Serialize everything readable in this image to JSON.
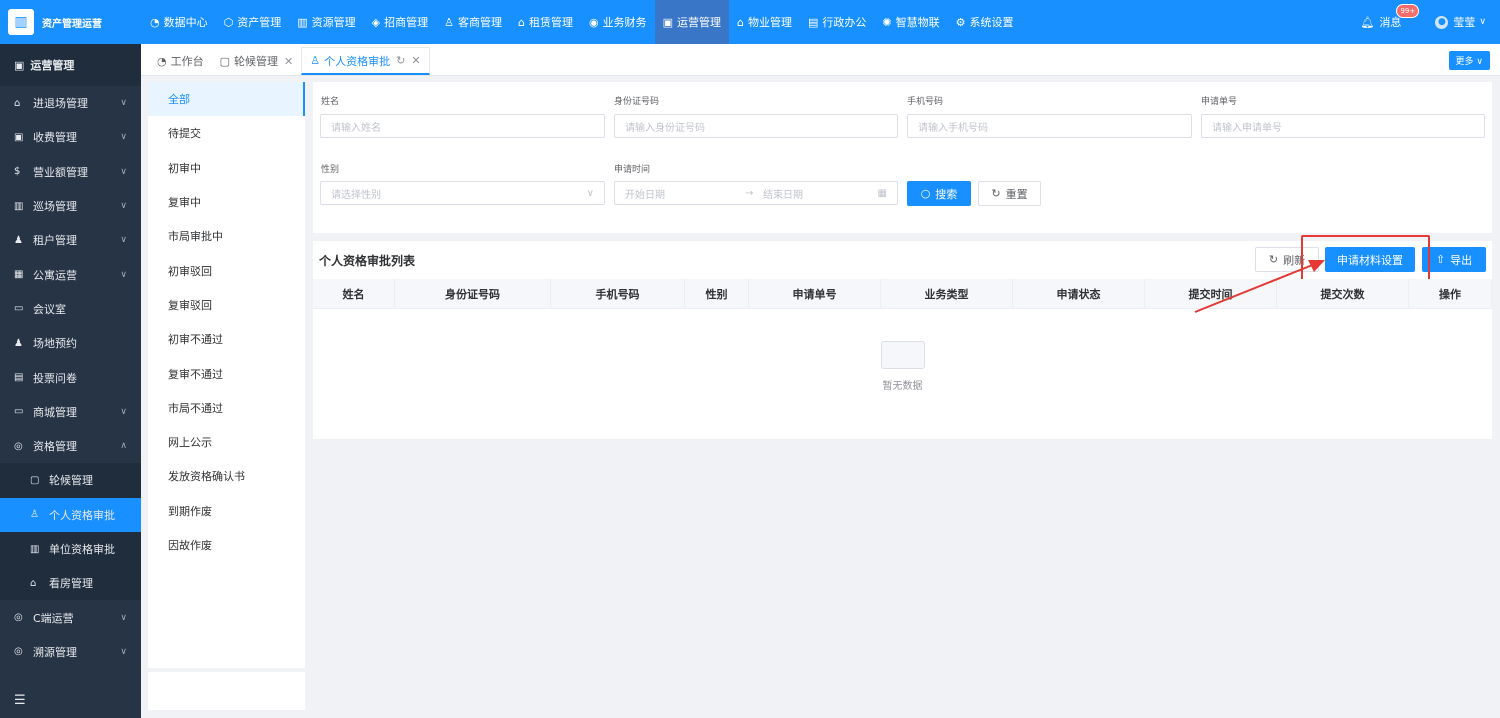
{
  "app": {
    "title": "资产管理运营",
    "logo_icon": "building-icon"
  },
  "topnav": [
    {
      "label": "数据中心",
      "icon": "dashboard-icon",
      "glyph": "◔"
    },
    {
      "label": "资产管理",
      "icon": "cube-icon",
      "glyph": "⬡"
    },
    {
      "label": "资源管理",
      "icon": "building-icon",
      "glyph": "▥"
    },
    {
      "label": "招商管理",
      "icon": "tag-icon",
      "glyph": "◈"
    },
    {
      "label": "客商管理",
      "icon": "users-icon",
      "glyph": "♙"
    },
    {
      "label": "租赁管理",
      "icon": "home-icon",
      "glyph": "⌂"
    },
    {
      "label": "业务财务",
      "icon": "coin-icon",
      "glyph": "◉"
    },
    {
      "label": "运营管理",
      "icon": "chart-icon",
      "glyph": "▣"
    },
    {
      "label": "物业管理",
      "icon": "house-icon",
      "glyph": "⌂"
    },
    {
      "label": "行政办公",
      "icon": "briefcase-icon",
      "glyph": "▤"
    },
    {
      "label": "智慧物联",
      "icon": "iot-icon",
      "glyph": "✺"
    },
    {
      "label": "系统设置",
      "icon": "gear-icon",
      "glyph": "⚙"
    }
  ],
  "topnav_active": 7,
  "header_right": {
    "messages": "消息",
    "badge": "99+",
    "user": "莹莹"
  },
  "sidebar": {
    "title": "运营管理",
    "items": [
      {
        "label": "进退场管理",
        "glyph": "⌂",
        "chev": "∨"
      },
      {
        "label": "收费管理",
        "glyph": "▣",
        "chev": "∨"
      },
      {
        "label": "营业额管理",
        "glyph": "$",
        "chev": "∨"
      },
      {
        "label": "巡场管理",
        "glyph": "▥",
        "chev": "∨"
      },
      {
        "label": "租户管理",
        "glyph": "♟",
        "chev": "∨"
      },
      {
        "label": "公寓运营",
        "glyph": "▦",
        "chev": "∨"
      },
      {
        "label": "会议室",
        "glyph": "▭",
        "chev": ""
      },
      {
        "label": "场地预约",
        "glyph": "♟",
        "chev": ""
      },
      {
        "label": "投票问卷",
        "glyph": "▤",
        "chev": ""
      },
      {
        "label": "商城管理",
        "glyph": "▭",
        "chev": "∨"
      },
      {
        "label": "资格管理",
        "glyph": "◎",
        "chev": "∧"
      }
    ],
    "subitems": [
      {
        "label": "轮候管理",
        "glyph": "▢"
      },
      {
        "label": "个人资格审批",
        "glyph": "♙"
      },
      {
        "label": "单位资格审批",
        "glyph": "▥"
      },
      {
        "label": "看房管理",
        "glyph": "⌂"
      }
    ],
    "subitem_active": 1,
    "items_after": [
      {
        "label": "C端运营",
        "glyph": "◎",
        "chev": "∨"
      },
      {
        "label": "溯源管理",
        "glyph": "◎",
        "chev": "∨"
      }
    ]
  },
  "tabs": [
    {
      "label": "工作台",
      "glyph": "◔",
      "close": ""
    },
    {
      "label": "轮候管理",
      "glyph": "▢",
      "close": "✕"
    },
    {
      "label": "个人资格审批",
      "glyph": "♙",
      "close": "✕",
      "refresh": "↻"
    }
  ],
  "more_label": "更多 ∨",
  "status_list": [
    "全部",
    "待提交",
    "初审中",
    "复审中",
    "市局审批中",
    "初审驳回",
    "复审驳回",
    "初审不通过",
    "复审不通过",
    "市局不通过",
    "网上公示",
    "发放资格确认书",
    "到期作废",
    "因故作废"
  ],
  "filter": {
    "name_label": "姓名",
    "name_ph": "请输入姓名",
    "id_label": "身份证号码",
    "id_ph": "请输入身份证号码",
    "phone_label": "手机号码",
    "phone_ph": "请输入手机号码",
    "no_label": "申请单号",
    "no_ph": "请输入申请单号",
    "gender_label": "性别",
    "gender_ph": "请选择性别",
    "date_label": "申请时间",
    "date_start": "开始日期",
    "date_sep": "→",
    "date_end": "结束日期",
    "search": "搜索",
    "reset": "重置"
  },
  "table": {
    "title": "个人资格审批列表",
    "refresh": "刷新",
    "material": "申请材料设置",
    "export": "导出",
    "columns": [
      "姓名",
      "身份证号码",
      "手机号码",
      "性别",
      "申请单号",
      "业务类型",
      "申请状态",
      "提交时间",
      "提交次数",
      "操作"
    ],
    "empty": "暂无数据"
  },
  "colors": {
    "primary": "#1890ff",
    "sidebar": "#263445",
    "annotation": "#e53935"
  }
}
